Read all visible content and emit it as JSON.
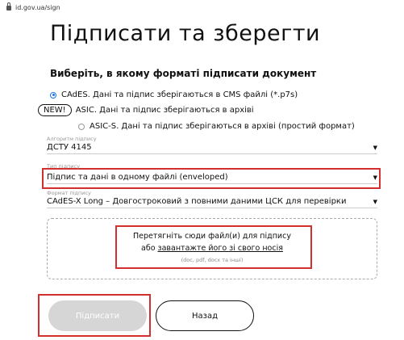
{
  "browser": {
    "url": "id.gov.ua/sign"
  },
  "page": {
    "title": "Підписати та зберегти",
    "format_heading": "Виберіть, в якому форматі підписати документ"
  },
  "formats": {
    "cades_label": "CAdES. Дані та підпис зберігаються в CMS файлі (*.p7s)",
    "new_badge": "NEW!",
    "asic_label": "ASIC. Дані та підпис зберігаються в архіві",
    "asic_s_label": "ASIC-S. Дані та підпис зберігаються в архіві (простий формат)",
    "selected": "CAdES"
  },
  "fields": {
    "algorithm_label": "Алгоритм підпису",
    "algorithm_value": "ДСТУ 4145",
    "sign_type_label": "Тип підпису",
    "sign_type_value": "Підпис та дані в одному файлі (enveloped)",
    "sign_format_label": "Формат підпису",
    "sign_format_value": "CAdES-X Long – Довгостроковий з повними даними ЦСК для перевірки"
  },
  "dropzone": {
    "line1": "Перетягніть сюди файл(и) для підпису",
    "line2_prefix": "або ",
    "line2_link": "завантажте його зі свого носія",
    "hint": "(doc, pdf, docx та інші)"
  },
  "buttons": {
    "sign": "Підписати",
    "back": "Назад"
  },
  "colors": {
    "accent": "#1a73e8",
    "highlight": "#d32f2f",
    "disabled_button": "#d6d6d6"
  }
}
